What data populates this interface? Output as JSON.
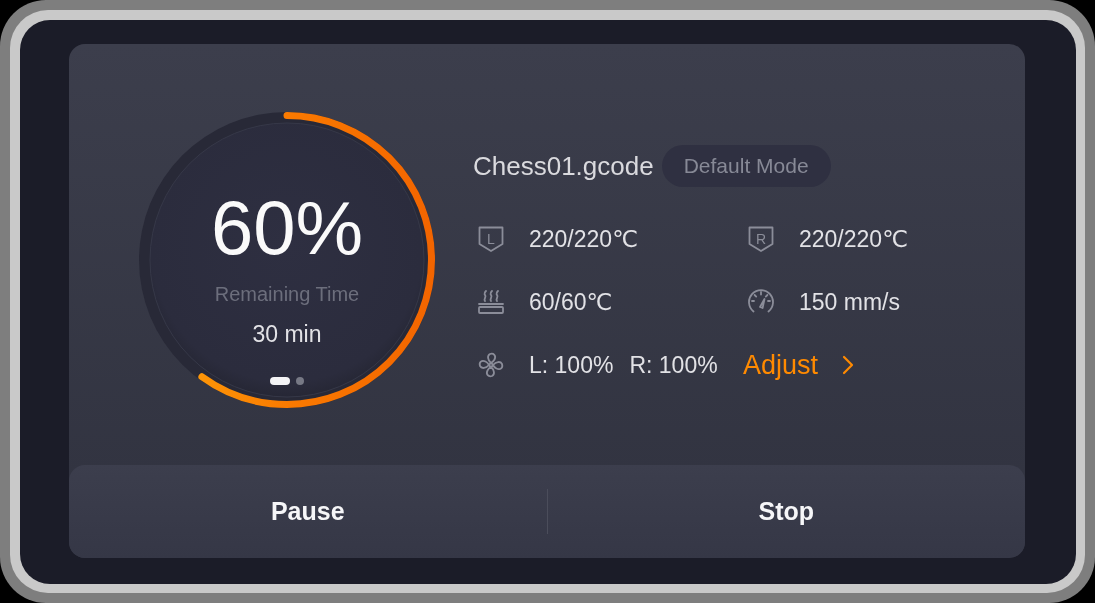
{
  "progress": {
    "percent": "60%",
    "level": 0.6,
    "label": "Remaining Time",
    "remaining": "30 min",
    "pages": [
      {
        "selected": true
      },
      {
        "selected": false
      }
    ]
  },
  "job": {
    "filename": "Chess01.gcode",
    "mode": "Default Mode"
  },
  "stats": [
    {
      "kind": "nozzle",
      "icon_letter": "L",
      "value": "220/220℃"
    },
    {
      "kind": "nozzle",
      "icon_letter": "R",
      "value": "220/220℃"
    },
    {
      "kind": "bed",
      "value": "60/60℃"
    },
    {
      "kind": "speed",
      "value": "150 mm/s"
    }
  ],
  "fans": {
    "left": "L: 100%",
    "right": "R: 100%"
  },
  "adjust": "Adjust",
  "buttons": [
    "Pause",
    "Stop"
  ]
}
